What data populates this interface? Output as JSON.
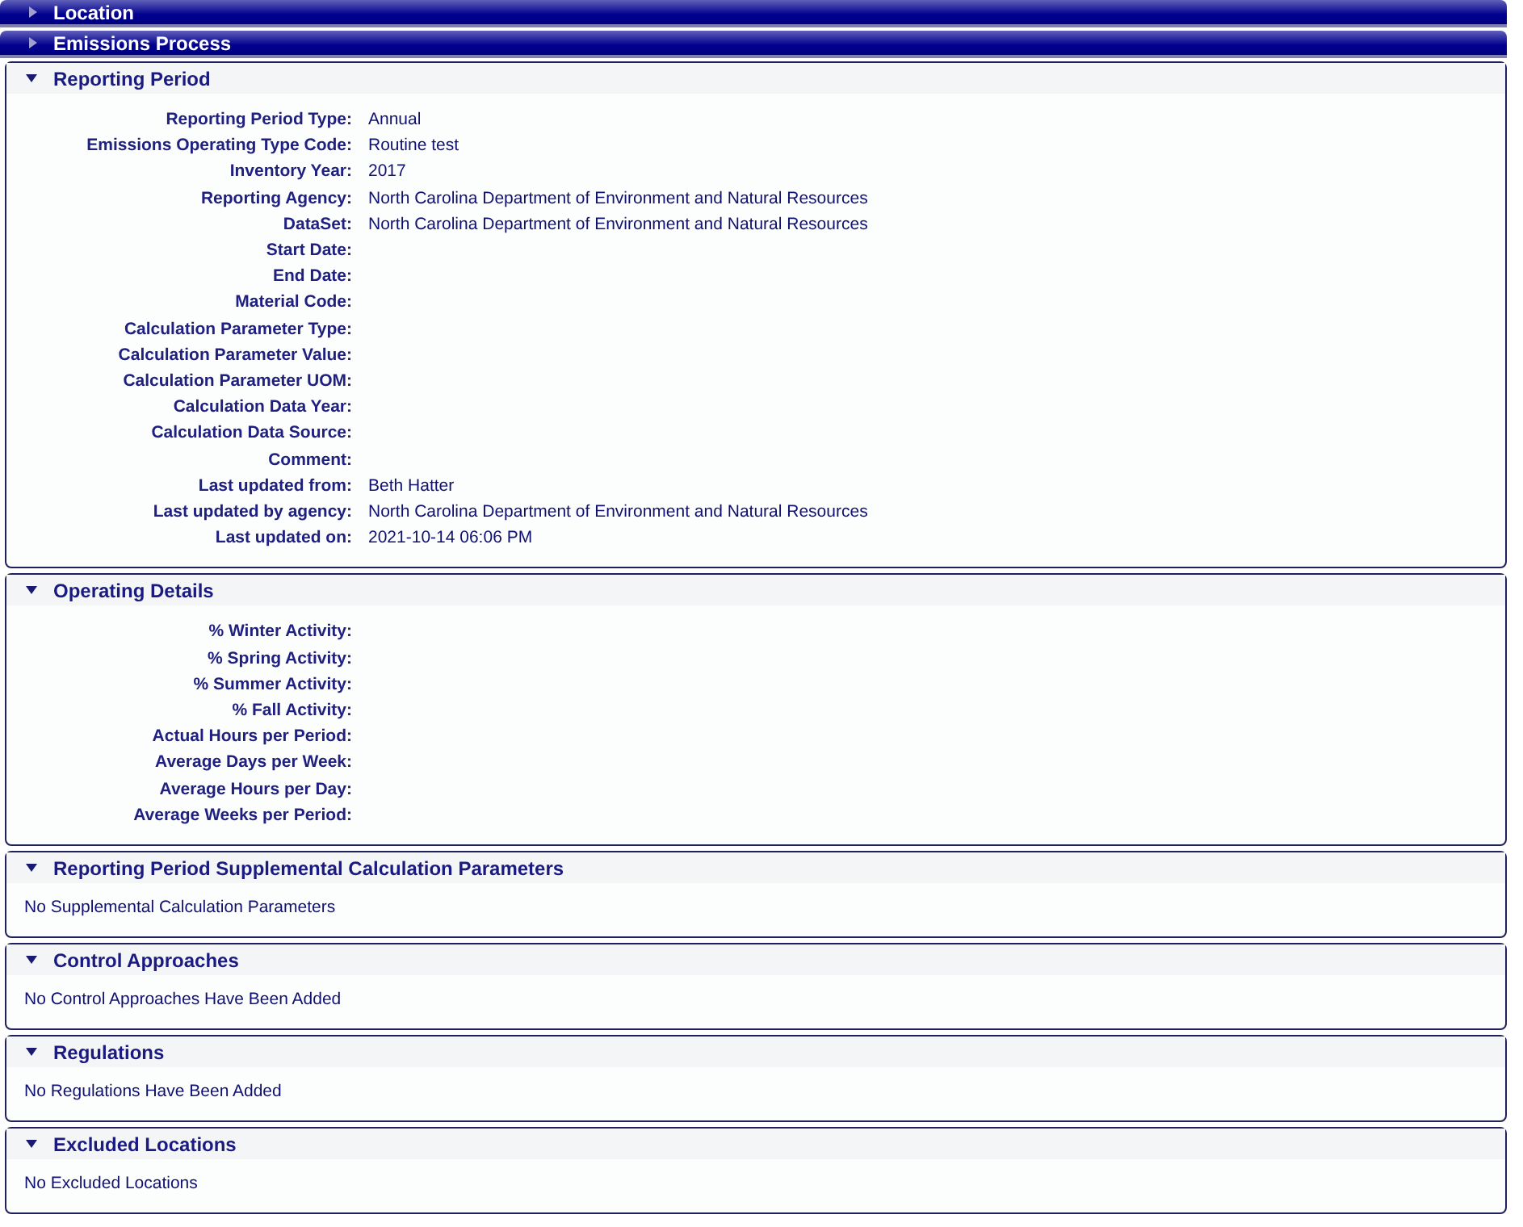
{
  "sections": [
    {
      "title": "Location",
      "expanded": false
    },
    {
      "title": "Emissions Process",
      "expanded": false
    },
    {
      "title": "Reporting Period",
      "expanded": true,
      "fields": [
        {
          "label": "Reporting Period Type:",
          "value": "Annual"
        },
        {
          "label": "Emissions Operating Type Code:",
          "value": "Routine test"
        },
        {
          "label": "Inventory Year:",
          "value": "2017"
        },
        {
          "label": "Reporting Agency:",
          "value": "North Carolina Department of Environment and Natural Resources"
        },
        {
          "label": "DataSet:",
          "value": "North Carolina Department of Environment and Natural Resources"
        },
        {
          "label": "Start Date:"
        },
        {
          "label": "End Date:"
        },
        {
          "label": "Material Code:"
        },
        {
          "label": "Calculation Parameter Type:"
        },
        {
          "label": "Calculation Parameter Value:"
        },
        {
          "label": "Calculation Parameter UOM:"
        },
        {
          "label": "Calculation Data Year:"
        },
        {
          "label": "Calculation Data Source:"
        },
        {
          "label": "Comment:"
        },
        {
          "label": "Last updated from:",
          "value": "Beth Hatter"
        },
        {
          "label": "Last updated by agency:",
          "value": "North Carolina Department of Environment and Natural Resources"
        },
        {
          "label": "Last updated on:",
          "value": "2021-10-14 06:06 PM"
        }
      ]
    },
    {
      "title": "Operating Details",
      "expanded": true,
      "fields": [
        {
          "label": "% Winter Activity:"
        },
        {
          "label": "% Spring Activity:"
        },
        {
          "label": "% Summer Activity:"
        },
        {
          "label": "% Fall Activity:"
        },
        {
          "label": "Actual Hours per Period:"
        },
        {
          "label": "Average Days per Week:"
        },
        {
          "label": "Average Hours per Day:"
        },
        {
          "label": "Average Weeks per Period:"
        }
      ]
    },
    {
      "title": "Reporting Period Supplemental Calculation Parameters",
      "expanded": true,
      "message": "No Supplemental Calculation Parameters"
    },
    {
      "title": "Control Approaches",
      "expanded": true,
      "message": "No Control Approaches Have Been Added"
    },
    {
      "title": "Regulations",
      "expanded": true,
      "message": "No Regulations Have Been Added"
    },
    {
      "title": "Excluded Locations",
      "expanded": true,
      "message": "No Excluded Locations"
    }
  ]
}
